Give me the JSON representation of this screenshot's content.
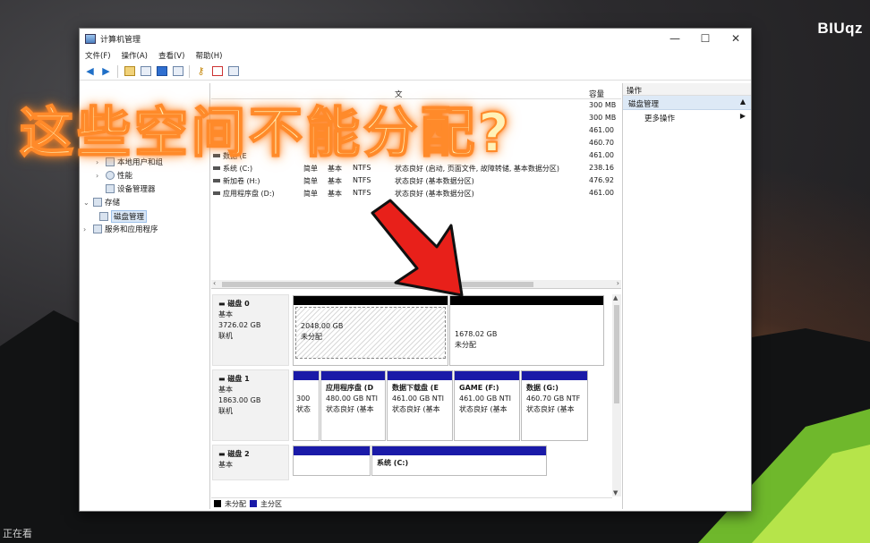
{
  "watermark": "BIUqz",
  "bottom_status": "正在看",
  "caption": "这些空间不能分配?",
  "window": {
    "title": "计算机管理",
    "controls": {
      "minimize": "—",
      "maximize": "☐",
      "close": "✕"
    },
    "menu": [
      "文件(F)",
      "操作(A)",
      "查看(V)",
      "帮助(H)"
    ],
    "toolbar_icons": [
      "back-arrow-icon",
      "forward-arrow-icon",
      "folder-up-icon",
      "properties-icon",
      "help-icon",
      "view-icon",
      "key-icon",
      "document-icon",
      "list-icon"
    ]
  },
  "tree": {
    "items": [
      {
        "label": "本地用户和组",
        "arrow": "›"
      },
      {
        "label": "性能",
        "arrow": "›"
      },
      {
        "label": "设备管理器",
        "arrow": ""
      },
      {
        "label": "存储",
        "arrow": "⌄"
      },
      {
        "label": "磁盘管理",
        "arrow": ""
      },
      {
        "label": "服务和应用程序",
        "arrow": "›"
      }
    ]
  },
  "volume_table": {
    "header": {
      "fs": "文",
      "capacity": "容量"
    },
    "rows": [
      {
        "volume": "",
        "layout": "",
        "type": "",
        "fs": "",
        "status": "",
        "capacity": "300 MB"
      },
      {
        "volume": "",
        "layout": "",
        "type": "",
        "fs": "",
        "status": "",
        "capacity": "300 MB"
      },
      {
        "volume": "",
        "layout": "",
        "type": "",
        "fs": "",
        "status": "",
        "capacity": "461.00"
      },
      {
        "volume": "",
        "layout": "",
        "type": "",
        "fs": "",
        "status": "",
        "capacity": "460.70"
      },
      {
        "volume": "数据 (E",
        "layout": "",
        "type": "",
        "fs": "",
        "status": "",
        "capacity": "461.00"
      },
      {
        "volume": "系统 (C:)",
        "layout": "简单",
        "type": "基本",
        "fs": "NTFS",
        "status": "状态良好 (启动, 页面文件, 故障转储, 基本数据分区)",
        "capacity": "238.16"
      },
      {
        "volume": "新加卷 (H:)",
        "layout": "简单",
        "type": "基本",
        "fs": "NTFS",
        "status": "状态良好 (基本数据分区)",
        "capacity": "476.92"
      },
      {
        "volume": "应用程序盘 (D:)",
        "layout": "简单",
        "type": "基本",
        "fs": "NTFS",
        "status": "状态良好 (基本数据分区)",
        "capacity": "461.00"
      }
    ]
  },
  "disks": [
    {
      "name": "磁盘 0",
      "type": "基本",
      "size": "3726.02 GB",
      "status": "联机",
      "partitions": [
        {
          "title": "",
          "size": "2048.00 GB",
          "status": "未分配"
        },
        {
          "title": "",
          "size": "1678.02 GB",
          "status": "未分配"
        }
      ]
    },
    {
      "name": "磁盘 1",
      "type": "基本",
      "size": "1863.00 GB",
      "status": "联机",
      "partitions": [
        {
          "title": "",
          "size": "300",
          "status": "状态"
        },
        {
          "title": "应用程序盘 (D",
          "size": "480.00 GB NTI",
          "status": "状态良好 (基本"
        },
        {
          "title": "数据下载盘 (E",
          "size": "461.00 GB NTI",
          "status": "状态良好 (基本"
        },
        {
          "title": "GAME (F:)",
          "size": "461.00 GB NTI",
          "status": "状态良好 (基本"
        },
        {
          "title": "数据 (G:)",
          "size": "460.70 GB NTF",
          "status": "状态良好 (基本"
        }
      ]
    },
    {
      "name": "磁盘 2",
      "type": "基本",
      "size": "",
      "status": "",
      "partitions": [
        {
          "title": "",
          "size": "",
          "status": ""
        },
        {
          "title": "系统 (C:)",
          "size": "",
          "status": ""
        }
      ]
    }
  ],
  "legend": {
    "unallocated": "未分配",
    "primary": "主分区"
  },
  "actions": {
    "header": "操作",
    "section": "磁盘管理",
    "more": "更多操作"
  },
  "colors": {
    "unallocated": "#000000",
    "primary": "#1a1aa8",
    "caption_fill": "#fff2b8",
    "caption_glow": "#ff8a2a",
    "arrow": "#e8201a"
  }
}
